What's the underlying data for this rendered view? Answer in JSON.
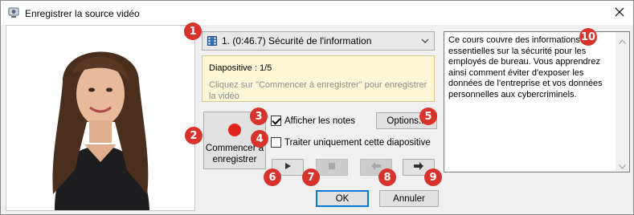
{
  "window": {
    "title": "Enregistrer la source vidéo"
  },
  "slide_select": {
    "value": "1. (0:46.7) Sécurité de l'information"
  },
  "info": {
    "slide_label": "Diapositive : 1/5",
    "hint": "Cliquez sur \"Commencer à enregistrer\" pour enregistrer la vidéo"
  },
  "record_button": {
    "label": "Commencer à enregistrer",
    "dot_color": "#e0241b"
  },
  "show_notes": {
    "label": "Afficher les notes",
    "checked": true
  },
  "this_slide_only": {
    "label": "Traiter uniquement cette diapositive",
    "checked": false
  },
  "options_button": {
    "label": "Options..."
  },
  "controls": {
    "play": "play-icon",
    "stop": "stop-icon",
    "prev": "arrow-left-icon",
    "next": "arrow-right-icon"
  },
  "ok_button": {
    "label": "OK"
  },
  "cancel_button": {
    "label": "Annuler"
  },
  "notes": {
    "text": "Ce cours couvre des informations essentielles sur la sécurité pour les employés de bureau. Vous apprendrez ainsi comment éviter d'exposer les données de l'entreprise et vos données personnelles aux cybercriminels."
  },
  "callouts": [
    "1",
    "2",
    "3",
    "4",
    "5",
    "6",
    "7",
    "8",
    "9",
    "10"
  ],
  "colors": {
    "callout": "#d8322c",
    "info_bg": "#fdf7d6",
    "accent": "#0078d7"
  }
}
